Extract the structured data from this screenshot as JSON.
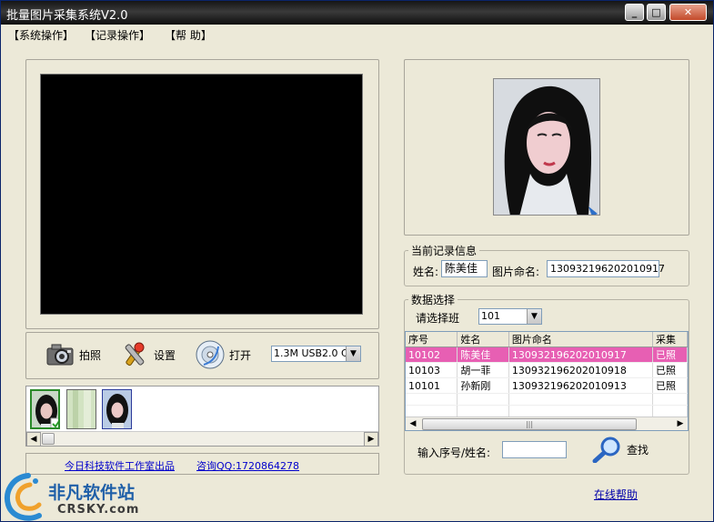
{
  "window": {
    "title": "批量图片采集系统V2.0",
    "controls": {
      "minimize": "_",
      "maximize": "□",
      "close": "✕"
    }
  },
  "menu": {
    "items": [
      "【系统操作】",
      "【记录操作】",
      "【帮  助】"
    ]
  },
  "toolbar": {
    "capture_label": "拍照",
    "settings_label": "设置",
    "open_label": "打开",
    "device_select": "1.3M USB2.0 C"
  },
  "footer": {
    "credit": "今日科技软件工作室出品",
    "contact": "咨询QQ:1720864278"
  },
  "record_info": {
    "legend": "当前记录信息",
    "name_label": "姓名:",
    "name_value": "陈美佳",
    "filename_label": "图片命名:",
    "filename_value": "130932196202010917"
  },
  "data_select": {
    "legend": "数据选择",
    "class_label": "请选择班",
    "class_value": "101",
    "columns": [
      "序号",
      "姓名",
      "图片命名",
      "采集"
    ],
    "rows": [
      {
        "id": "10102",
        "name": "陈美佳",
        "file": "130932196202010917",
        "status": "已照",
        "selected": true
      },
      {
        "id": "10103",
        "name": "胡一菲",
        "file": "130932196202010918",
        "status": "已照",
        "selected": false
      },
      {
        "id": "10101",
        "name": "孙新刚",
        "file": "130932196202010913",
        "status": "已照",
        "selected": false
      }
    ],
    "search_label": "输入序号/姓名:",
    "search_value": "",
    "search_button": "查找"
  },
  "help_link": "在线帮助",
  "watermark": {
    "brand": "非凡软件站",
    "domain": "CRSKY.com"
  },
  "colors": {
    "selection_row": "#e75fb3",
    "link": "#0000cc",
    "window_bg": "#ece9d8"
  }
}
